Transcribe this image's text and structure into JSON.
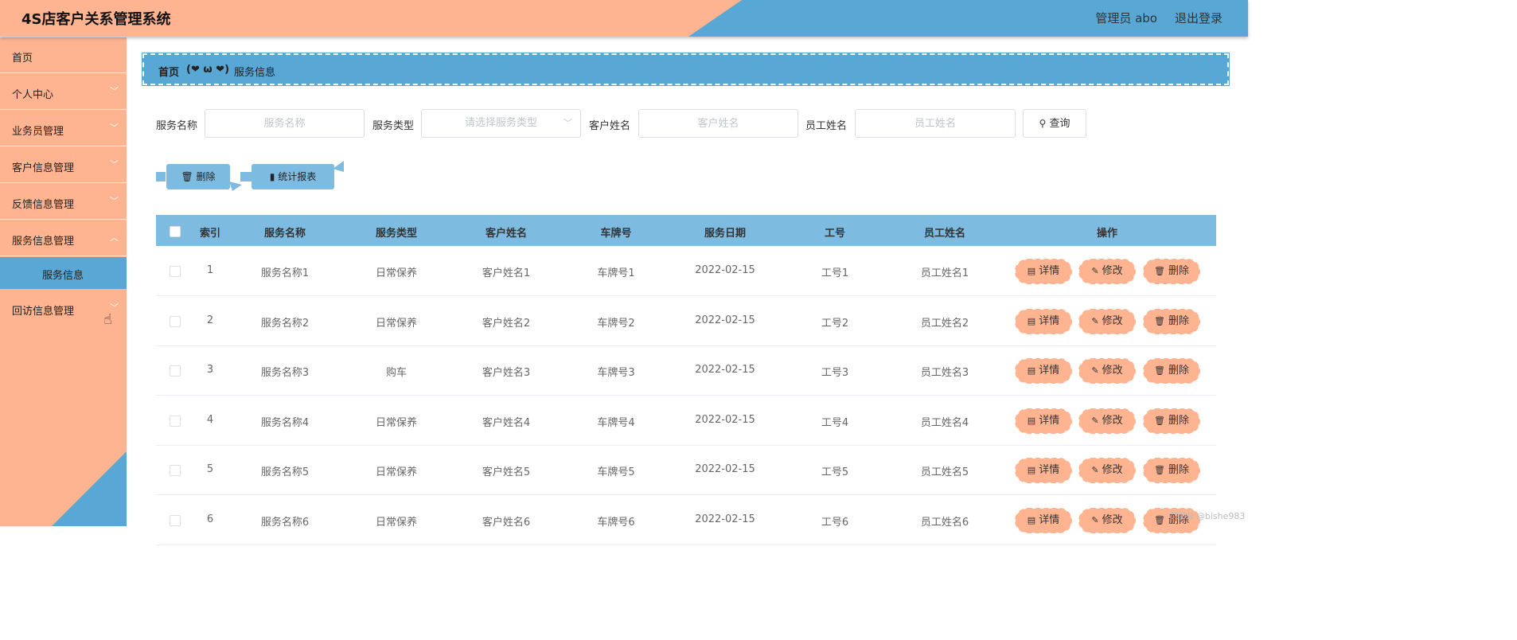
{
  "app": {
    "title": "4S店客户关系管理系统"
  },
  "header": {
    "user_label": "管理员 abo",
    "logout_label": "退出登录"
  },
  "sidebar": {
    "items": [
      {
        "label": "首页"
      },
      {
        "label": "个人中心"
      },
      {
        "label": "业务员管理"
      },
      {
        "label": "客户信息管理"
      },
      {
        "label": "反馈信息管理"
      },
      {
        "label": "服务信息管理"
      },
      {
        "label": "服务信息"
      },
      {
        "label": "回访信息管理"
      }
    ]
  },
  "breadcrumb": {
    "home": "首页",
    "separator": "(❤ ω ❤)",
    "current": "服务信息"
  },
  "search": {
    "fields": [
      {
        "label": "服务名称",
        "placeholder": "服务名称"
      },
      {
        "label": "服务类型",
        "placeholder": "请选择服务类型"
      },
      {
        "label": "客户姓名",
        "placeholder": "客户姓名"
      },
      {
        "label": "员工姓名",
        "placeholder": "员工姓名"
      }
    ],
    "query_label": "查询"
  },
  "actions": {
    "delete_label": "删除",
    "report_label": "统计报表"
  },
  "table": {
    "columns": [
      "索引",
      "服务名称",
      "服务类型",
      "客户姓名",
      "车牌号",
      "服务日期",
      "工号",
      "员工姓名",
      "操作"
    ],
    "rows": [
      [
        "1",
        "服务名称1",
        "日常保养",
        "客户姓名1",
        "车牌号1",
        "2022-02-15",
        "工号1",
        "员工姓名1"
      ],
      [
        "2",
        "服务名称2",
        "日常保养",
        "客户姓名2",
        "车牌号2",
        "2022-02-15",
        "工号2",
        "员工姓名2"
      ],
      [
        "3",
        "服务名称3",
        "购车",
        "客户姓名3",
        "车牌号3",
        "2022-02-15",
        "工号3",
        "员工姓名3"
      ],
      [
        "4",
        "服务名称4",
        "日常保养",
        "客户姓名4",
        "车牌号4",
        "2022-02-15",
        "工号4",
        "员工姓名4"
      ],
      [
        "5",
        "服务名称5",
        "日常保养",
        "客户姓名5",
        "车牌号5",
        "2022-02-15",
        "工号5",
        "员工姓名5"
      ],
      [
        "6",
        "服务名称6",
        "日常保养",
        "客户姓名6",
        "车牌号6",
        "2022-02-15",
        "工号6",
        "员工姓名6"
      ]
    ],
    "row_actions": {
      "detail": "详情",
      "edit": "修改",
      "delete": "删除"
    }
  },
  "watermark": "CSDN @bishe983",
  "colors": {
    "salmon": "#ffb491",
    "blue": "#58a7d4",
    "light_blue": "#7ebbe0"
  }
}
